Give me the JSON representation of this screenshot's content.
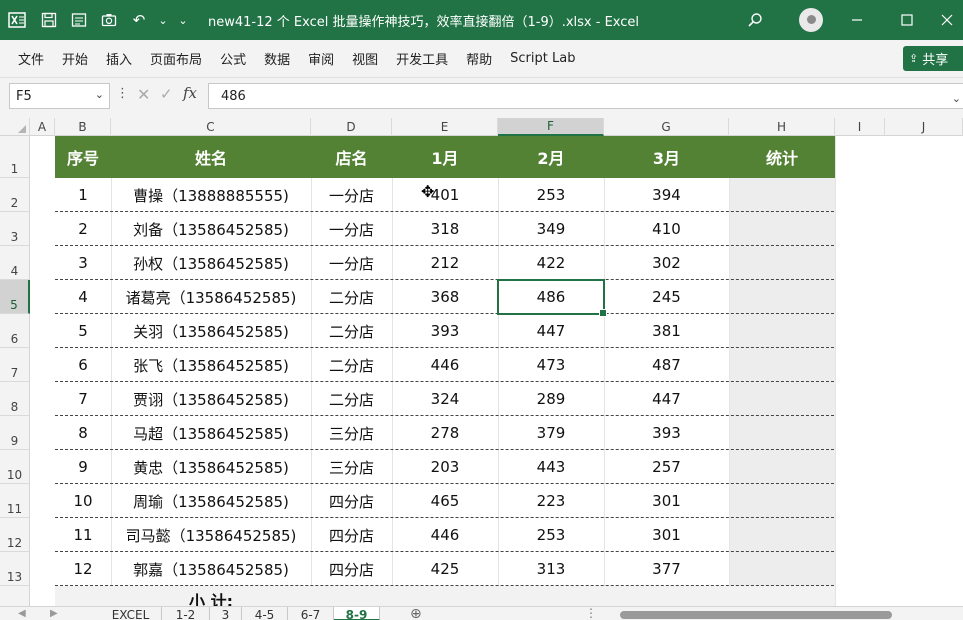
{
  "titlebar": {
    "title": "new41-12 个 Excel 批量操作神技巧，效率直接翻倍（1-9）.xlsx  -  Excel",
    "undo_icon": "↶",
    "search_icon": "⌕"
  },
  "menu": {
    "items": [
      "文件",
      "开始",
      "插入",
      "页面布局",
      "公式",
      "数据",
      "审阅",
      "视图",
      "开发工具",
      "帮助",
      "Script Lab"
    ],
    "share_label": "共享"
  },
  "formula_bar": {
    "name_box": "F5",
    "fx_label": "fx",
    "formula": "486"
  },
  "columns": [
    "A",
    "B",
    "C",
    "D",
    "E",
    "F",
    "G",
    "H",
    "I",
    "J"
  ],
  "selected_column": "F",
  "rows": [
    "1",
    "2",
    "3",
    "4",
    "5",
    "6",
    "7",
    "8",
    "9",
    "10",
    "11",
    "12",
    "13"
  ],
  "selected_row": "5",
  "table": {
    "headers": [
      "序号",
      "姓名",
      "店名",
      "1月",
      "2月",
      "3月",
      "统计"
    ],
    "rows": [
      [
        "1",
        "曹操（13888885555)",
        "一分店",
        "401",
        "253",
        "394"
      ],
      [
        "2",
        "刘备（13586452585)",
        "一分店",
        "318",
        "349",
        "410"
      ],
      [
        "3",
        "孙权（13586452585)",
        "一分店",
        "212",
        "422",
        "302"
      ],
      [
        "4",
        "诸葛亮（13586452585)",
        "二分店",
        "368",
        "486",
        "245"
      ],
      [
        "5",
        "关羽（13586452585)",
        "二分店",
        "393",
        "447",
        "381"
      ],
      [
        "6",
        "张飞（13586452585)",
        "二分店",
        "446",
        "473",
        "487"
      ],
      [
        "7",
        "贾诩（13586452585)",
        "二分店",
        "324",
        "289",
        "447"
      ],
      [
        "8",
        "马超（13586452585)",
        "三分店",
        "278",
        "379",
        "393"
      ],
      [
        "9",
        "黄忠（13586452585)",
        "三分店",
        "203",
        "443",
        "257"
      ],
      [
        "10",
        "周瑜（13586452585)",
        "四分店",
        "465",
        "223",
        "301"
      ],
      [
        "11",
        "司马懿（13586452585)",
        "四分店",
        "446",
        "253",
        "301"
      ],
      [
        "12",
        "郭嘉（13586452585)",
        "四分店",
        "425",
        "313",
        "377"
      ]
    ],
    "subtotal_label": "小 计:"
  },
  "sheets": {
    "tabs": [
      "EXCEL",
      "1-2",
      "3",
      "4-5",
      "6-7",
      "8-9"
    ],
    "active": "8-9"
  },
  "colors": {
    "title_bar": "#217346",
    "table_header": "#548235",
    "selection": "#217346"
  }
}
